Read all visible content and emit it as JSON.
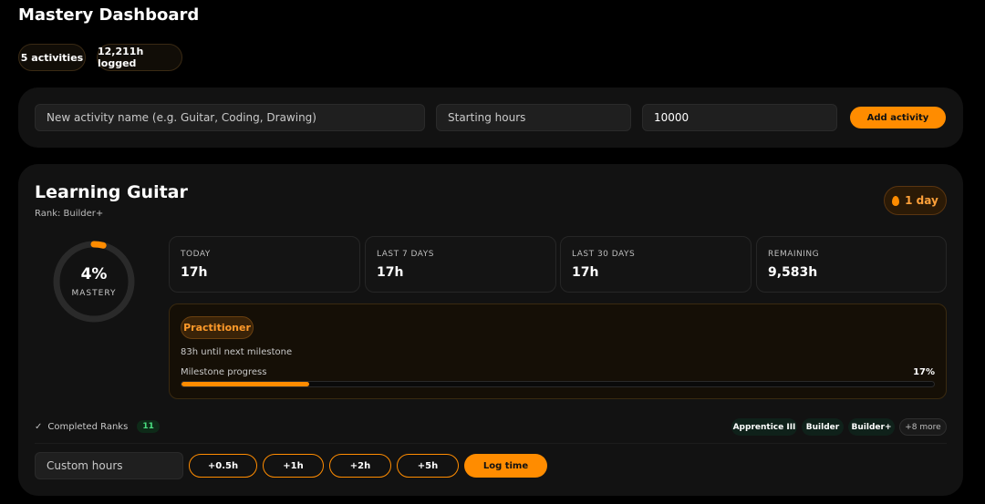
{
  "app": {
    "title": "Mastery Dashboard"
  },
  "summary": {
    "activities": "5 activities",
    "logged": "12,211h logged"
  },
  "add_form": {
    "name_placeholder": "New activity name (e.g. Guitar, Coding, Drawing)",
    "start_placeholder": "Starting hours",
    "target_value": "10000",
    "add_label": "Add activity"
  },
  "activity": {
    "title": "Learning Guitar",
    "rank": "Rank: Builder+",
    "streak": "1 day",
    "mastery_pct_label": "4%",
    "mastery_fraction": 0.04,
    "mastery_label": "MASTERY",
    "stats": [
      {
        "label": "TODAY",
        "value": "17h"
      },
      {
        "label": "LAST 7 DAYS",
        "value": "17h"
      },
      {
        "label": "LAST 30 DAYS",
        "value": "17h"
      },
      {
        "label": "REMAINING",
        "value": "9,583h"
      }
    ],
    "milestone": {
      "tier": "Practitioner",
      "next": "83h until next milestone",
      "progress_label": "Milestone progress",
      "progress_pct_label": "17%",
      "progress_fraction": 0.17
    },
    "completed": {
      "label": "Completed Ranks",
      "count": "11"
    },
    "rank_tags": [
      "Apprentice III",
      "Builder",
      "Builder+",
      "+8 more"
    ],
    "custom_placeholder": "Custom hours",
    "increments": [
      "+0.5h",
      "+1h",
      "+2h",
      "+5h"
    ],
    "log_label": "Log time"
  },
  "colors": {
    "accent": "#ff8c00",
    "success": "#4ade80",
    "background": "#000000",
    "panel": "#121212"
  }
}
